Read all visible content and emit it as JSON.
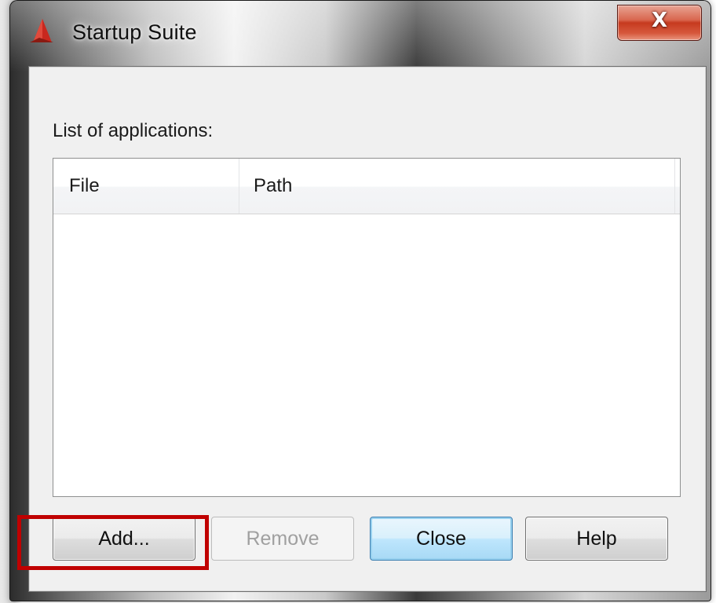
{
  "window": {
    "title": "Startup Suite",
    "close_glyph": "X",
    "icon": "autocad-logo-icon"
  },
  "dialog": {
    "list_label": "List of applications:",
    "columns": [
      "File",
      "Path"
    ],
    "rows": []
  },
  "buttons": {
    "add": "Add...",
    "remove": "Remove",
    "close": "Close",
    "help": "Help"
  },
  "annotation": {
    "highlight_color": "#c00000",
    "highlights": "add-button"
  },
  "colors": {
    "close_button_red": "#c63a1f",
    "default_button_blue": "#3c7fb1"
  }
}
